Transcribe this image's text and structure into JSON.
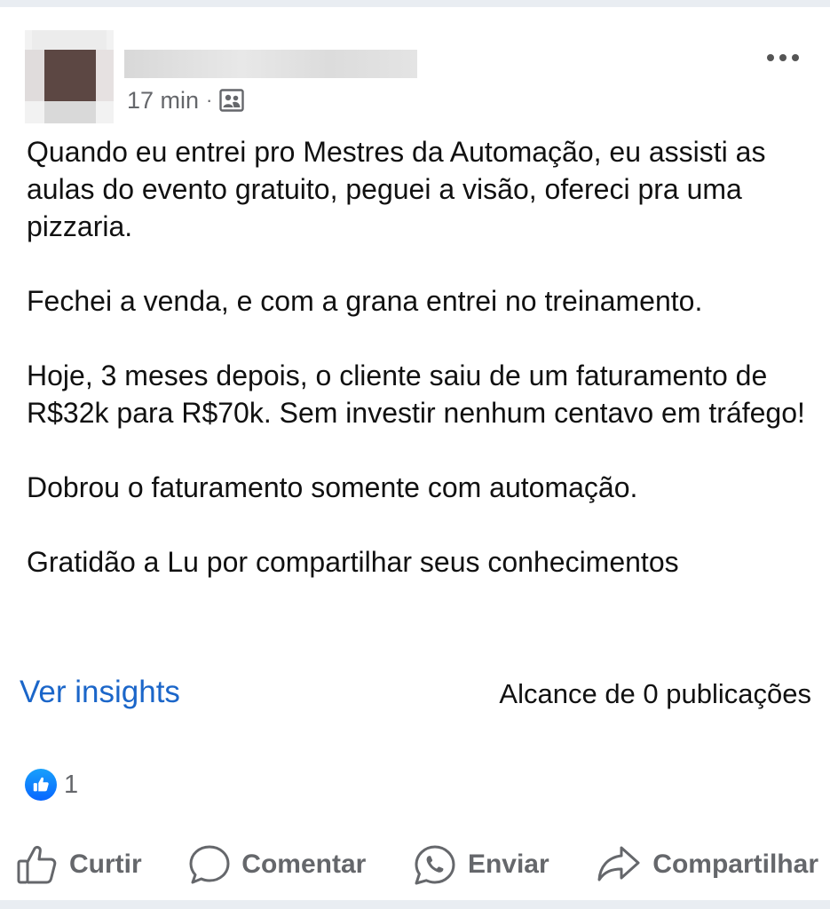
{
  "post": {
    "time": "17 min",
    "separator": "·",
    "audience_icon": "friends-audience-icon",
    "paragraphs": [
      "Quando eu entrei pro Mestres da Automação, eu assisti as aulas do evento gratuito, peguei a visão, ofereci pra uma pizzaria.",
      "Fechei a venda, e com a grana entrei no treinamento.",
      "Hoje, 3 meses depois, o cliente saiu de um faturamento de R$32k para R$70k. Sem investir nenhum centavo em tráfego!",
      "Dobrou o faturamento somente com automação.",
      "Gratidão a Lu por compartilhar seus conhecimentos"
    ]
  },
  "insights": {
    "link_label": "Ver insights",
    "reach_text": "Alcance de 0 publicações"
  },
  "reactions": {
    "icon": "like-reaction-icon",
    "count": "1"
  },
  "actions": {
    "like_label": "Curtir",
    "comment_label": "Comentar",
    "send_label": "Enviar",
    "share_label": "Compartilhar"
  },
  "colors": {
    "link_blue": "#1b66c9",
    "secondary_text": "#65676b",
    "like_blue": "#0866ff"
  }
}
